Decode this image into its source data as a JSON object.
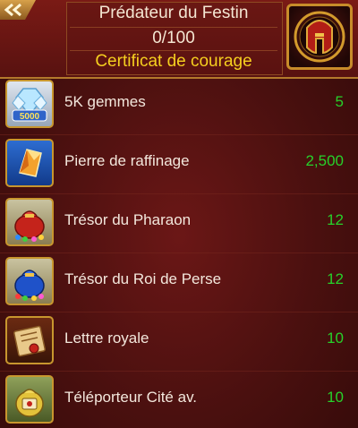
{
  "header": {
    "title": "Prédateur du Festin",
    "progress": "0/100",
    "subtitle": "Certificat de courage",
    "back_icon": "double-arrow-left-icon",
    "emblem_icon": "spartan-helmet-icon"
  },
  "items": [
    {
      "name": "5K gemmes",
      "count": "5",
      "icon": "gems-5000-icon",
      "icon_text": "5000"
    },
    {
      "name": "Pierre de raffinage",
      "count": "2,500",
      "icon": "refining-stone-icon"
    },
    {
      "name": "Trésor du Pharaon",
      "count": "12",
      "icon": "red-treasure-bag-icon"
    },
    {
      "name": "Trésor du Roi de Perse",
      "count": "12",
      "icon": "blue-treasure-bag-icon"
    },
    {
      "name": "Lettre royale",
      "count": "10",
      "icon": "royal-letter-icon"
    },
    {
      "name": "Téléporteur Cité av.",
      "count": "10",
      "icon": "teleporter-bag-icon"
    }
  ],
  "colors": {
    "count": "#27d12a",
    "subtitle": "#f5cf1f",
    "frame": "#c8962e"
  }
}
